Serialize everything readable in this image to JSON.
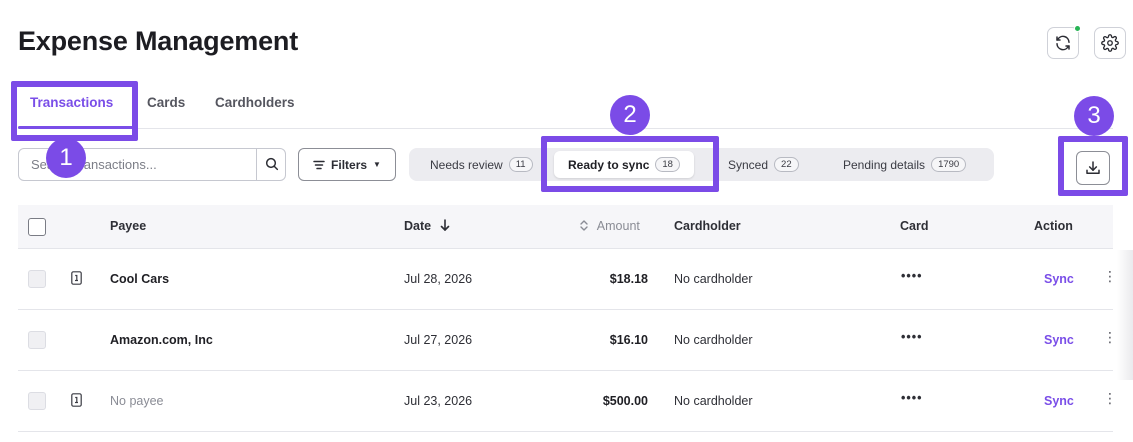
{
  "page": {
    "title": "Expense Management"
  },
  "header_actions": {
    "sync_icon": "refresh-icon",
    "settings_icon": "gear-icon"
  },
  "tabs": [
    {
      "label": "Transactions",
      "active": true
    },
    {
      "label": "Cards",
      "active": false
    },
    {
      "label": "Cardholders",
      "active": false
    }
  ],
  "search": {
    "placeholder": "Search transactions...",
    "value": ""
  },
  "filters": {
    "label": "Filters"
  },
  "segments": [
    {
      "label": "Needs review",
      "count": "11",
      "active": false
    },
    {
      "label": "Ready to sync",
      "count": "18",
      "active": true
    },
    {
      "label": "Synced",
      "count": "22",
      "active": false
    },
    {
      "label": "Pending details",
      "count": "1790",
      "active": false
    }
  ],
  "download": {
    "icon": "download-icon"
  },
  "table": {
    "columns": {
      "payee": "Payee",
      "date": "Date",
      "amount": "Amount",
      "cardholder": "Cardholder",
      "card": "Card",
      "action": "Action"
    },
    "rows": [
      {
        "payee": "Cool Cars",
        "date": "Jul 28, 2026",
        "amount": "$18.18",
        "cardholder": "No cardholder",
        "card": "••••",
        "action": "Sync",
        "has_receipt": true
      },
      {
        "payee": "Amazon.com, Inc",
        "date": "Jul 27, 2026",
        "amount": "$16.10",
        "cardholder": "No cardholder",
        "card": "••••",
        "action": "Sync",
        "has_receipt": false
      },
      {
        "payee": "No payee",
        "date": "Jul 23, 2026",
        "amount": "$500.00",
        "cardholder": "No cardholder",
        "card": "••••",
        "action": "Sync",
        "has_receipt": true
      }
    ]
  },
  "callouts": [
    "1",
    "2",
    "3"
  ],
  "colors": {
    "accent": "#7a4ee8",
    "callout": "#7b4be7",
    "status_dot": "#27b455"
  }
}
